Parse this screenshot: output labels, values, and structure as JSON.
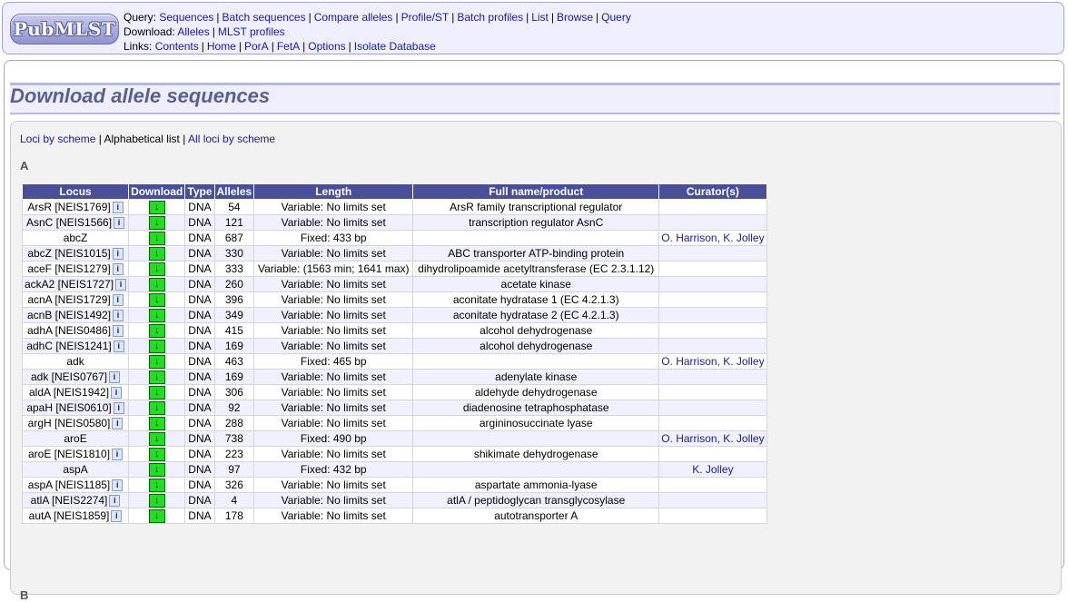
{
  "header": {
    "logo_text": "PubMLST",
    "query_label": "Query:",
    "query_links": [
      "Sequences",
      "Batch sequences",
      "Compare alleles",
      "Profile/ST",
      "Batch profiles",
      "List",
      "Browse",
      "Query"
    ],
    "download_label": "Download:",
    "download_links": [
      "Alleles",
      "MLST profiles"
    ],
    "links_label": "Links:",
    "nav_links": [
      "Contents",
      "Home",
      "PorA",
      "FetA",
      "Options",
      "Isolate Database"
    ]
  },
  "page": {
    "title": "Download allele sequences",
    "tabs": {
      "by_scheme": "Loci by scheme",
      "separator": "|",
      "alphabetical": "Alphabetical list",
      "all_loci": "All loci by scheme"
    },
    "section_a": "A",
    "section_b": "B"
  },
  "table": {
    "headers": [
      "Locus",
      "Download",
      "Type",
      "Alleles",
      "Length",
      "Full name/product",
      "Curator(s)"
    ],
    "info_icon_text": "i",
    "download_icon_text": "↓",
    "rows": [
      {
        "locus": "ArsR [NEIS1769]",
        "info": true,
        "type": "DNA",
        "alleles": "54",
        "length": "Variable: No limits set",
        "name": "ArsR family transcriptional regulator",
        "curator": ""
      },
      {
        "locus": "AsnC [NEIS1566]",
        "info": true,
        "type": "DNA",
        "alleles": "121",
        "length": "Variable: No limits set",
        "name": "transcription regulator AsnC",
        "curator": ""
      },
      {
        "locus": "abcZ",
        "info": false,
        "type": "DNA",
        "alleles": "687",
        "length": "Fixed: 433 bp",
        "name": "",
        "curator": "O. Harrison, K. Jolley"
      },
      {
        "locus": "abcZ [NEIS1015]",
        "info": true,
        "type": "DNA",
        "alleles": "330",
        "length": "Variable: No limits set",
        "name": "ABC transporter ATP-binding protein",
        "curator": ""
      },
      {
        "locus": "aceF [NEIS1279]",
        "info": true,
        "type": "DNA",
        "alleles": "333",
        "length": "Variable: (1563 min; 1641 max)",
        "name": "dihydrolipoamide acetyltransferase (EC 2.3.1.12)",
        "curator": ""
      },
      {
        "locus": "ackA2 [NEIS1727]",
        "info": true,
        "type": "DNA",
        "alleles": "260",
        "length": "Variable: No limits set",
        "name": "acetate kinase",
        "curator": ""
      },
      {
        "locus": "acnA [NEIS1729]",
        "info": true,
        "type": "DNA",
        "alleles": "396",
        "length": "Variable: No limits set",
        "name": "aconitate hydratase 1 (EC 4.2.1.3)",
        "curator": ""
      },
      {
        "locus": "acnB [NEIS1492]",
        "info": true,
        "type": "DNA",
        "alleles": "349",
        "length": "Variable: No limits set",
        "name": "aconitate hydratase 2 (EC 4.2.1.3)",
        "curator": ""
      },
      {
        "locus": "adhA [NEIS0486]",
        "info": true,
        "type": "DNA",
        "alleles": "415",
        "length": "Variable: No limits set",
        "name": "alcohol dehydrogenase",
        "curator": ""
      },
      {
        "locus": "adhC [NEIS1241]",
        "info": true,
        "type": "DNA",
        "alleles": "169",
        "length": "Variable: No limits set",
        "name": "alcohol dehydrogenase",
        "curator": ""
      },
      {
        "locus": "adk",
        "info": false,
        "type": "DNA",
        "alleles": "463",
        "length": "Fixed: 465 bp",
        "name": "",
        "curator": "O. Harrison, K. Jolley"
      },
      {
        "locus": "adk [NEIS0767]",
        "info": true,
        "type": "DNA",
        "alleles": "169",
        "length": "Variable: No limits set",
        "name": "adenylate kinase",
        "curator": ""
      },
      {
        "locus": "aldA [NEIS1942]",
        "info": true,
        "type": "DNA",
        "alleles": "306",
        "length": "Variable: No limits set",
        "name": "aldehyde dehydrogenase",
        "curator": ""
      },
      {
        "locus": "apaH [NEIS0610]",
        "info": true,
        "type": "DNA",
        "alleles": "92",
        "length": "Variable: No limits set",
        "name": "diadenosine tetraphosphatase",
        "curator": ""
      },
      {
        "locus": "argH [NEIS0580]",
        "info": true,
        "type": "DNA",
        "alleles": "288",
        "length": "Variable: No limits set",
        "name": "argininosuccinate lyase",
        "curator": ""
      },
      {
        "locus": "aroE",
        "info": false,
        "type": "DNA",
        "alleles": "738",
        "length": "Fixed: 490 bp",
        "name": "",
        "curator": "O. Harrison, K. Jolley"
      },
      {
        "locus": "aroE [NEIS1810]",
        "info": true,
        "type": "DNA",
        "alleles": "223",
        "length": "Variable: No limits set",
        "name": "shikimate dehydrogenase",
        "curator": ""
      },
      {
        "locus": "aspA",
        "info": false,
        "type": "DNA",
        "alleles": "97",
        "length": "Fixed: 432 bp",
        "name": "",
        "curator": "K. Jolley"
      },
      {
        "locus": "aspA [NEIS1185]",
        "info": true,
        "type": "DNA",
        "alleles": "326",
        "length": "Variable: No limits set",
        "name": "aspartate ammonia-lyase",
        "curator": ""
      },
      {
        "locus": "atlA [NEIS2274]",
        "info": true,
        "type": "DNA",
        "alleles": "4",
        "length": "Variable: No limits set",
        "name": "atlA / peptidoglycan transglycosylase",
        "curator": ""
      },
      {
        "locus": "autA [NEIS1859]",
        "info": true,
        "type": "DNA",
        "alleles": "178",
        "length": "Variable: No limits set",
        "name": "autotransporter A",
        "curator": ""
      }
    ]
  },
  "colors": {
    "header_bg": "#4b4f99",
    "download_green": "#22dd22",
    "link": "#1a1aa6",
    "title": "#5a5f8f"
  }
}
